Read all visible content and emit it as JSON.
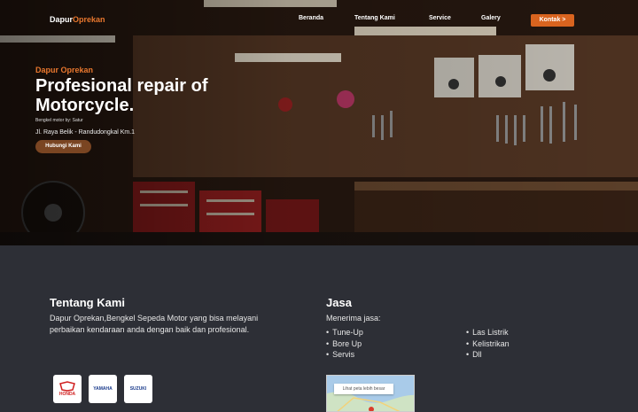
{
  "brand": {
    "part1": "Dapur",
    "part2": "Oprekan"
  },
  "nav": {
    "items": [
      "Beranda",
      "Tentang Kami",
      "Service",
      "Galery"
    ],
    "cta": "Kontak >"
  },
  "hero": {
    "kicker": "Dapur Oprekan",
    "headline_line1": "Profesional repair of",
    "headline_line2": "Motorcycle.",
    "tagline": "Bengkel motor by: Satur",
    "address": "Jl. Raya Belik - Randudongkal Km.1",
    "button": "Hubungi Kami"
  },
  "about": {
    "title": "Tentang Kami",
    "text": "Dapur Oprekan,Bengkel Sepeda Motor yang bisa melayani perbaikan kendaraan anda dengan baik dan profesional.",
    "brands": [
      "HONDA",
      "YAMAHA",
      "SUZUKI"
    ]
  },
  "services": {
    "title": "Jasa",
    "intro": "Menerima jasa:",
    "left": [
      "Tune-Up",
      "Bore Up",
      "Servis"
    ],
    "right": [
      "Las Listrik",
      "Kelistrikan",
      "Dll"
    ]
  },
  "map": {
    "button": "Lihat peta lebih besar"
  },
  "colors": {
    "accent": "#e8772e",
    "background": "#2d2f36",
    "cta": "#d9641f"
  }
}
